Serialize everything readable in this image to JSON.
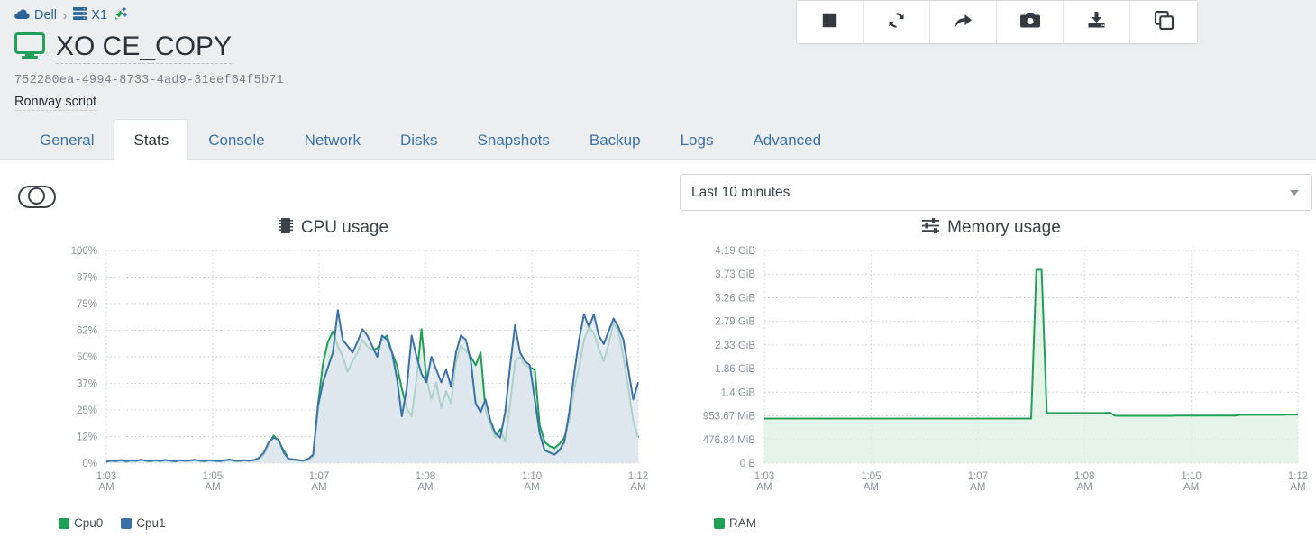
{
  "breadcrumb": {
    "pool": "Dell",
    "host": "X1",
    "pool_icon": "cloud-icon",
    "host_icon": "server-icon",
    "status_icon": "network-plug-icon",
    "separator": "›"
  },
  "vm": {
    "icon": "monitor-icon",
    "icon_color": "#21a25a",
    "name": "XO CE_COPY",
    "uuid": "752280ea-4994-8733-4ad9-31eef64f5b71",
    "description": "Ronivay script"
  },
  "toolbar": {
    "buttons": [
      {
        "name": "stop-button",
        "icon": "stop-square-icon",
        "label": "Stop"
      },
      {
        "name": "reboot-button",
        "icon": "refresh-cycle-icon",
        "label": "Reboot"
      },
      {
        "name": "migrate-button",
        "icon": "arrow-forward-icon",
        "label": "Migrate"
      },
      {
        "name": "snapshot-button",
        "icon": "camera-icon",
        "label": "Snapshot"
      },
      {
        "name": "export-button",
        "icon": "download-inbox-icon",
        "label": "Export"
      },
      {
        "name": "copy-button",
        "icon": "copy-pages-icon",
        "label": "Copy"
      }
    ]
  },
  "tabs": [
    {
      "label": "General",
      "active": false
    },
    {
      "label": "Stats",
      "active": true
    },
    {
      "label": "Console",
      "active": false
    },
    {
      "label": "Network",
      "active": false
    },
    {
      "label": "Disks",
      "active": false
    },
    {
      "label": "Snapshots",
      "active": false
    },
    {
      "label": "Backup",
      "active": false
    },
    {
      "label": "Logs",
      "active": false
    },
    {
      "label": "Advanced",
      "active": false
    }
  ],
  "controls": {
    "toggle": {
      "name": "stats-toggle",
      "state": "off"
    },
    "range": {
      "selected": "Last 10 minutes",
      "caret_icon": "chevron-down-icon"
    }
  },
  "chart_data": [
    {
      "type": "line",
      "name": "cpu-usage-chart",
      "title": "CPU usage",
      "title_icon": "cpu-chip-icon",
      "xlabel": "",
      "ylabel": "",
      "ylim": [
        0,
        100
      ],
      "yticks": [
        "0%",
        "12%",
        "25%",
        "37%",
        "50%",
        "62%",
        "75%",
        "87%",
        "100%"
      ],
      "ytick_values": [
        0,
        12,
        25,
        37,
        50,
        62,
        75,
        87,
        100
      ],
      "xticks": [
        "1:03 AM",
        "1:05 AM",
        "1:07 AM",
        "1:08 AM",
        "1:10 AM",
        "1:12 AM"
      ],
      "xtick_positions": [
        0,
        20,
        40,
        60,
        80,
        100
      ],
      "grid": true,
      "legend_position": "bottom-left",
      "series": [
        {
          "name": "Cpu0",
          "color": "#1fa055",
          "fill": "#d5e7e0",
          "values": [
            0.5,
            1,
            0.8,
            1.2,
            0.6,
            1,
            0.9,
            1.4,
            1,
            0.7,
            1.1,
            0.8,
            1.3,
            1,
            0.6,
            1.2,
            0.9,
            1,
            1.4,
            1,
            0.8,
            1.2,
            1,
            0.7,
            1.1,
            1.5,
            1,
            0.9,
            1.2,
            1,
            1.3,
            2,
            4,
            9,
            13,
            10,
            6,
            2,
            1.5,
            1.2,
            1,
            1.5,
            3,
            28,
            47,
            57,
            62,
            55,
            50,
            43,
            48,
            52,
            58,
            55,
            53,
            54,
            58,
            60,
            52,
            46,
            35,
            26,
            22,
            40,
            63,
            40,
            30,
            38,
            26,
            34,
            28,
            48,
            55,
            53,
            50,
            46,
            52,
            25,
            18,
            12,
            16,
            10,
            28,
            48,
            50,
            46,
            45,
            44,
            18,
            10,
            8,
            7,
            9,
            12,
            20,
            35,
            45,
            58,
            64,
            61,
            54,
            48,
            56,
            66,
            62,
            50,
            35,
            20,
            12
          ],
          "peak": 66,
          "trough": 0.5
        },
        {
          "name": "Cpu1",
          "color": "#3a72a8",
          "fill": "#dde4f0",
          "values": [
            0.8,
            1.2,
            1,
            1.5,
            0.9,
            1.3,
            1.1,
            1.6,
            1.2,
            1,
            1.4,
            1.1,
            1.5,
            1.2,
            0.9,
            1.4,
            1.2,
            1.3,
            1.6,
            1.2,
            1,
            1.4,
            1.2,
            1,
            1.3,
            1.7,
            1.2,
            1.1,
            1.4,
            1.2,
            1.5,
            2.5,
            5,
            10,
            12,
            11,
            5,
            2,
            1.8,
            1.5,
            1.2,
            2,
            4,
            27,
            38,
            45,
            52,
            72,
            58,
            55,
            52,
            57,
            63,
            60,
            55,
            50,
            60,
            58,
            52,
            40,
            22,
            35,
            60,
            50,
            42,
            38,
            50,
            44,
            38,
            44,
            36,
            52,
            60,
            58,
            48,
            28,
            24,
            30,
            20,
            14,
            12,
            24,
            46,
            65,
            52,
            48,
            46,
            30,
            14,
            6,
            5,
            4,
            6,
            10,
            24,
            42,
            58,
            70,
            64,
            70,
            60,
            56,
            62,
            68,
            64,
            58,
            44,
            30,
            38
          ],
          "peak": 72,
          "trough": 0.8
        }
      ]
    },
    {
      "type": "line",
      "name": "memory-usage-chart",
      "title": "Memory usage",
      "title_icon": "memory-sliders-icon",
      "xlabel": "",
      "ylabel": "",
      "ylim_bytes": [
        0,
        4500000000
      ],
      "yticks": [
        "0 B",
        "476.84 MiB",
        "953.67 MiB",
        "1.4 GiB",
        "1.86 GiB",
        "2.33 GiB",
        "2.79 GiB",
        "3.26 GiB",
        "3.73 GiB",
        "4.19 GiB"
      ],
      "ytick_values_mib": [
        0,
        476.84,
        953.67,
        1433.6,
        1904.6,
        2385.9,
        2856.4,
        3338.2,
        3819.0,
        4290.6
      ],
      "xticks": [
        "1:03 AM",
        "1:05 AM",
        "1:07 AM",
        "1:08 AM",
        "1:10 AM",
        "1:12 AM"
      ],
      "grid": true,
      "legend_position": "bottom-left",
      "series": [
        {
          "name": "RAM",
          "color": "#1fa055",
          "fill": "#dcefe1",
          "unit": "MiB",
          "values": [
            900,
            900,
            900,
            900,
            900,
            900,
            900,
            900,
            900,
            900,
            900,
            900,
            900,
            900,
            900,
            900,
            900,
            900,
            900,
            900,
            900,
            900,
            900,
            900,
            900,
            900,
            900,
            900,
            900,
            900,
            900,
            900,
            900,
            900,
            900,
            900,
            900,
            900,
            900,
            900,
            900,
            900,
            900,
            900,
            900,
            900,
            900,
            900,
            900,
            900,
            900,
            900,
            3900,
            3900,
            1010,
            1010,
            1010,
            1010,
            1010,
            1010,
            1010,
            1010,
            1010,
            1010,
            1010,
            1010,
            1020,
            960,
            955,
            955,
            955,
            955,
            955,
            955,
            955,
            955,
            955,
            955,
            955,
            960,
            960,
            960,
            960,
            960,
            960,
            960,
            960,
            960,
            960,
            960,
            960,
            975,
            975,
            975,
            975,
            975,
            975,
            975,
            975,
            975,
            980,
            980,
            980
          ],
          "peak": 3900,
          "baseline": 900
        }
      ]
    }
  ]
}
